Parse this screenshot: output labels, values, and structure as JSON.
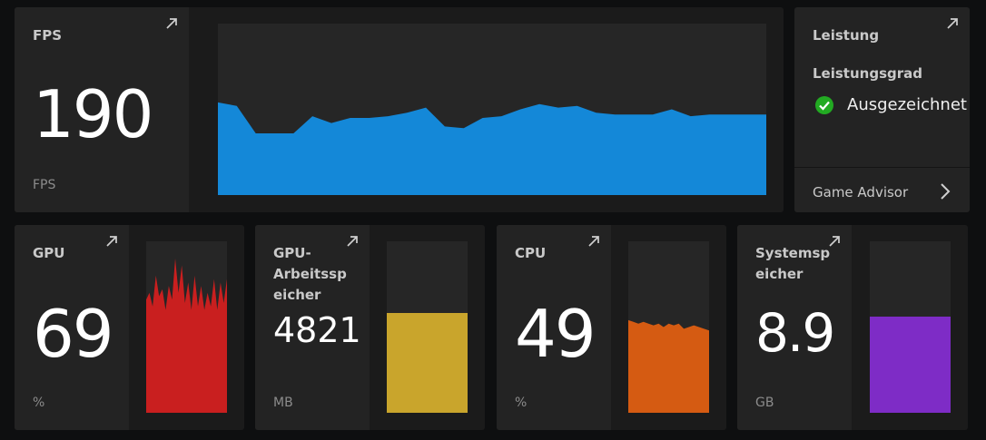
{
  "fps": {
    "title": "FPS",
    "value": "190",
    "unit": "FPS",
    "series": [
      0.54,
      0.52,
      0.36,
      0.36,
      0.36,
      0.46,
      0.42,
      0.45,
      0.45,
      0.46,
      0.48,
      0.51,
      0.4,
      0.39,
      0.45,
      0.46,
      0.5,
      0.53,
      0.51,
      0.52,
      0.48,
      0.47,
      0.47,
      0.47,
      0.5,
      0.46,
      0.47,
      0.47,
      0.47,
      0.47
    ],
    "color": "#1488d8"
  },
  "leistung": {
    "title": "Leistung",
    "subtitle": "Leistungsgrad",
    "status": "Ausgezeichnet",
    "advisor": "Game Advisor",
    "status_color": "#22aa22"
  },
  "gpu": {
    "title": "GPU",
    "value": "69",
    "unit": "%",
    "series": [
      0.66,
      0.7,
      0.62,
      0.8,
      0.68,
      0.72,
      0.6,
      0.74,
      0.66,
      0.9,
      0.7,
      0.86,
      0.64,
      0.76,
      0.6,
      0.8,
      0.62,
      0.74,
      0.6,
      0.7,
      0.62,
      0.78,
      0.6,
      0.76,
      0.64,
      0.78
    ],
    "color": "#c91f1f"
  },
  "gpu_mem": {
    "title": "GPU-\nArbeitssp\neicher",
    "value": "4821",
    "unit": "MB",
    "fill": 0.58,
    "color": "#c9a52c"
  },
  "cpu": {
    "title": "CPU",
    "value": "49",
    "unit": "%",
    "series": [
      0.54,
      0.53,
      0.52,
      0.53,
      0.52,
      0.51,
      0.52,
      0.5,
      0.52,
      0.51,
      0.52,
      0.49,
      0.5,
      0.51,
      0.5,
      0.49,
      0.48
    ],
    "color": "#d55b12"
  },
  "sys_mem": {
    "title": "Systemsp\neicher",
    "value": "8.9",
    "unit": "GB",
    "fill": 0.56,
    "color": "#7e2cc6"
  }
}
